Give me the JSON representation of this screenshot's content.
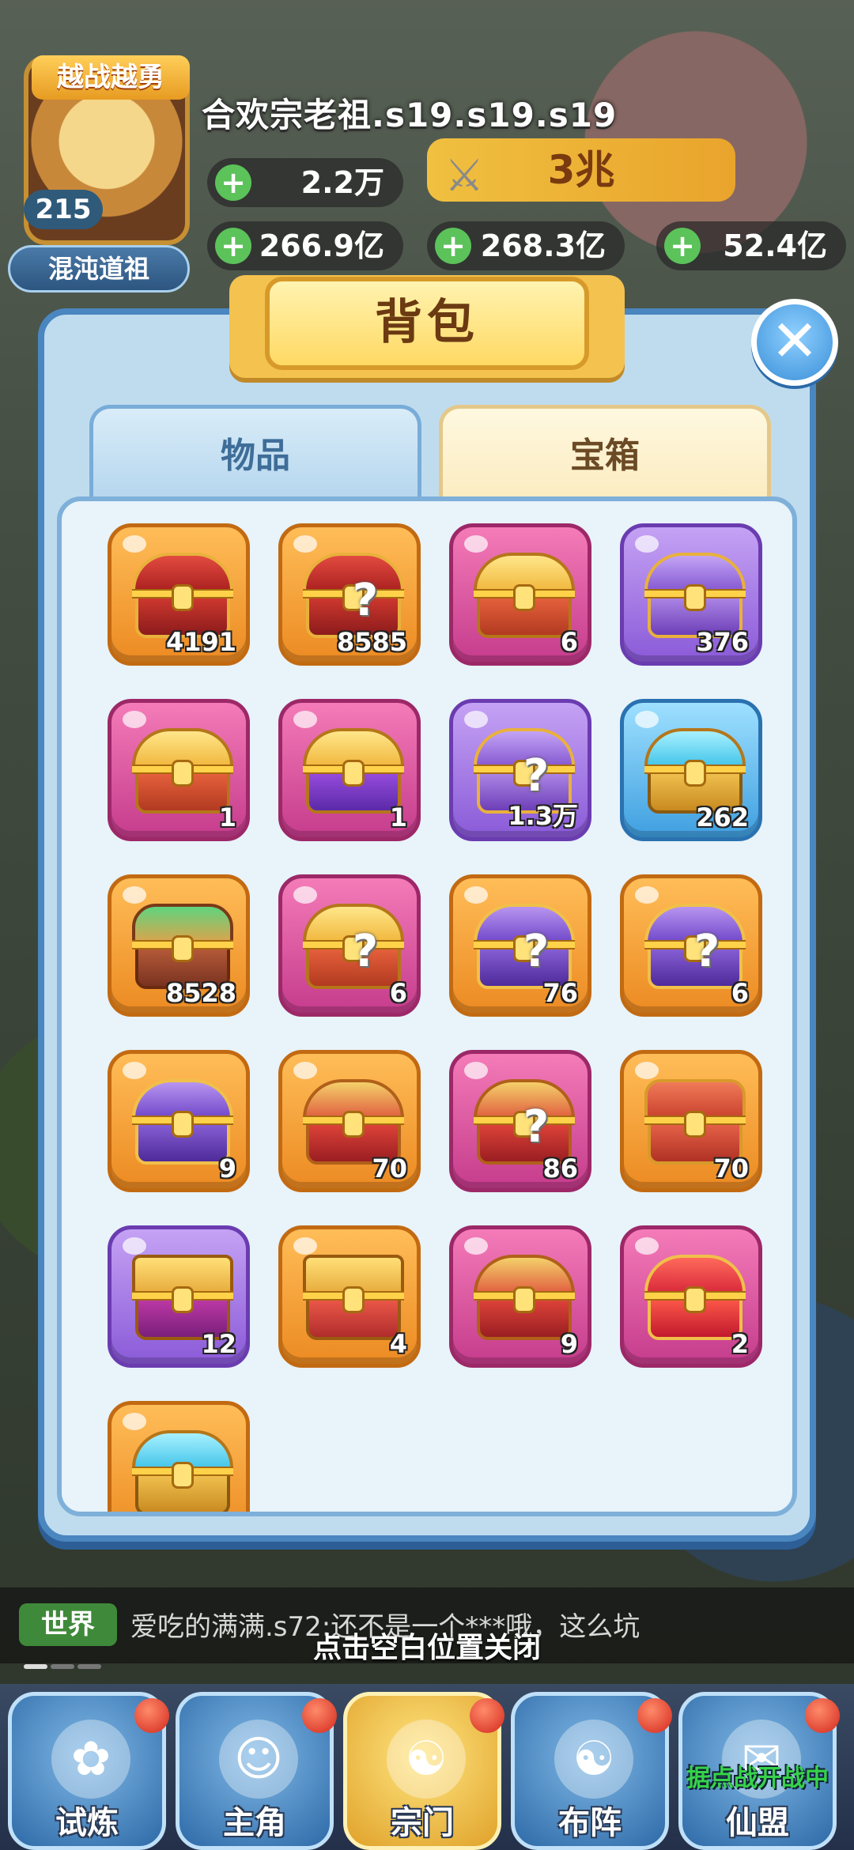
{
  "hud": {
    "badge": "越战越勇",
    "level": "215",
    "rank_title": "混沌道祖",
    "player_name": "合欢宗老祖.s19.s19.s19",
    "resource_1": "2.2万",
    "power": "3兆",
    "resource_2": "266.9亿",
    "resource_3": "268.3亿",
    "resource_4": "52.4亿"
  },
  "modal": {
    "title": "背包",
    "tabs": [
      {
        "label": "物品",
        "active": false
      },
      {
        "label": "宝箱",
        "active": true
      }
    ],
    "close_icon": "close-x"
  },
  "chests": [
    {
      "count": "4191",
      "bg": "orange",
      "theme": "c-red",
      "mystery": false
    },
    {
      "count": "8585",
      "bg": "orange",
      "theme": "c-red",
      "mystery": true
    },
    {
      "count": "6",
      "bg": "pink",
      "theme": "c-gold",
      "mystery": false
    },
    {
      "count": "376",
      "bg": "purple",
      "theme": "c-purple",
      "mystery": false
    },
    {
      "count": "1",
      "bg": "pink",
      "theme": "c-gold",
      "mystery": false
    },
    {
      "count": "1",
      "bg": "pink",
      "theme": "c-violetbox",
      "mystery": false
    },
    {
      "count": "1.3万",
      "bg": "purple",
      "theme": "c-purple",
      "mystery": true
    },
    {
      "count": "262",
      "bg": "blue",
      "theme": "c-cyan",
      "mystery": false
    },
    {
      "count": "8528",
      "bg": "orange",
      "theme": "c-crate",
      "mystery": false
    },
    {
      "count": "6",
      "bg": "pink",
      "theme": "c-gold",
      "mystery": true
    },
    {
      "count": "76",
      "bg": "orange",
      "theme": "c-royal",
      "mystery": true
    },
    {
      "count": "6",
      "bg": "orange",
      "theme": "c-royal",
      "mystery": true
    },
    {
      "count": "9",
      "bg": "orange",
      "theme": "c-royal",
      "mystery": false
    },
    {
      "count": "70",
      "bg": "orange",
      "theme": "c-crimson",
      "mystery": false
    },
    {
      "count": "86",
      "bg": "pink",
      "theme": "c-crimson",
      "mystery": true
    },
    {
      "count": "70",
      "bg": "orange",
      "theme": "c-tech",
      "mystery": false
    },
    {
      "count": "12",
      "bg": "purple",
      "theme": "c-orb",
      "mystery": false
    },
    {
      "count": "4",
      "bg": "orange",
      "theme": "c-orbred",
      "mystery": false
    },
    {
      "count": "9",
      "bg": "pink",
      "theme": "c-crimson",
      "mystery": false
    },
    {
      "count": "2",
      "bg": "pink",
      "theme": "c-jewel",
      "mystery": false
    },
    {
      "count": "",
      "bg": "orange",
      "theme": "c-cyan",
      "mystery": false
    }
  ],
  "chat": {
    "channel": "世界",
    "message": "爱吃的满满.s72:还不是一个***哦，这么坑",
    "close_hint": "点击空白位置关闭"
  },
  "nav": {
    "items": [
      {
        "label": "试炼",
        "icon": "trial-icon",
        "glyph": "✿"
      },
      {
        "label": "主角",
        "icon": "hero-icon",
        "glyph": "☺"
      },
      {
        "label": "宗门",
        "icon": "sect-icon",
        "glyph": "☯"
      },
      {
        "label": "布阵",
        "icon": "formation-icon",
        "glyph": "☯"
      },
      {
        "label": "仙盟",
        "icon": "alliance-icon",
        "glyph": "✉"
      }
    ],
    "notice": "据点战开战中"
  }
}
